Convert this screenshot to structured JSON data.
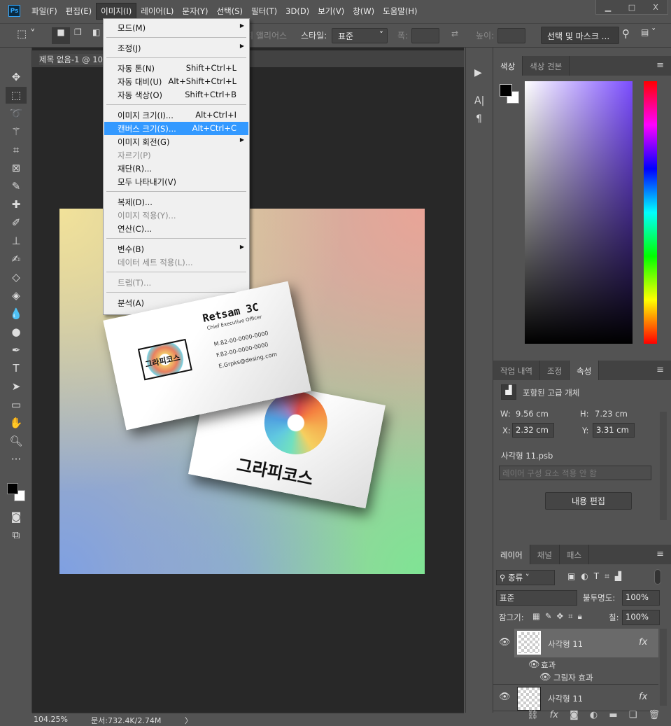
{
  "app": {
    "logo": "Ps",
    "window_controls": [
      "minimize-icon",
      "maximize-icon",
      "close-icon"
    ]
  },
  "menubar": [
    "파일(F)",
    "편집(E)",
    "이미지(I)",
    "레이어(L)",
    "문자(Y)",
    "선택(S)",
    "필터(T)",
    "3D(D)",
    "보기(V)",
    "창(W)",
    "도움말(H)"
  ],
  "options": {
    "antialias": "앤티 앨리어스",
    "style_label": "스타일:",
    "style_value": "표준",
    "width_label": "폭:",
    "height_label": "높이:",
    "select_mask": "선택 및 마스크 ..."
  },
  "document": {
    "tab_title": "제목 없음-1 @ 10",
    "zoom": "104.25%",
    "doc_size": "문서:732.4K/2.74M"
  },
  "image_menu": [
    {
      "label": "모드(M)",
      "submenu": true
    },
    {
      "sep": true
    },
    {
      "label": "조정(J)",
      "submenu": true
    },
    {
      "sep": true
    },
    {
      "label": "자동 톤(N)",
      "shortcut": "Shift+Ctrl+L"
    },
    {
      "label": "자동 대비(U)",
      "shortcut": "Alt+Shift+Ctrl+L"
    },
    {
      "label": "자동 색상(O)",
      "shortcut": "Shift+Ctrl+B"
    },
    {
      "sep": true
    },
    {
      "label": "이미지 크기(I)...",
      "shortcut": "Alt+Ctrl+I"
    },
    {
      "label": "캔버스 크기(S)...",
      "shortcut": "Alt+Ctrl+C",
      "highlighted": true
    },
    {
      "label": "이미지 회전(G)",
      "submenu": true
    },
    {
      "label": "자르기(P)",
      "disabled": true
    },
    {
      "label": "재단(R)..."
    },
    {
      "label": "모두 나타내기(V)"
    },
    {
      "sep": true
    },
    {
      "label": "복제(D)..."
    },
    {
      "label": "이미지 적용(Y)...",
      "disabled": true
    },
    {
      "label": "연산(C)..."
    },
    {
      "sep": true
    },
    {
      "label": "변수(B)",
      "submenu": true
    },
    {
      "label": "데이터 세트 적용(L)...",
      "disabled": true
    },
    {
      "sep": true
    },
    {
      "label": "트랩(T)...",
      "disabled": true
    },
    {
      "sep": true
    },
    {
      "label": "분석(A)",
      "submenu": true
    }
  ],
  "card_front": {
    "name": "Retsam 3C",
    "title": "Chief Executive Officer",
    "mobile": "M.82-00-0000-0000",
    "fax": "F.82-00-0000-0000",
    "email": "E.Grpks@desing.com",
    "logo_text": "그라피코스"
  },
  "card_back": {
    "logo_text": "그라피코스"
  },
  "color_panel": {
    "tabs": [
      "색상",
      "색상 견본"
    ],
    "foreground": "#000000",
    "background": "#ffffff",
    "hue_color": "#7b4dff"
  },
  "properties_panel": {
    "tabs": [
      "작업 내역",
      "조정",
      "속성"
    ],
    "type": "포함된 고급 개체",
    "w_label": "W:",
    "w": "9.56 cm",
    "h_label": "H:",
    "h": "7.23 cm",
    "x_label": "X:",
    "x": "2.32 cm",
    "y_label": "Y:",
    "y": "3.31 cm",
    "file": "사각형  11.psb",
    "comp": "레이어 구성 요소 적용 안 함",
    "edit_btn": "내용 편집"
  },
  "layers_panel": {
    "tabs": [
      "레이어",
      "채널",
      "패스"
    ],
    "filter": "종류",
    "blend": "표준",
    "opacity_label": "불투명도:",
    "opacity": "100%",
    "lock_label": "잠그기:",
    "fill_label": "칠:",
    "fill": "100%",
    "layers": [
      {
        "name": "사각형  11",
        "fx": "fx",
        "effects_label": "효과",
        "effect": "그림자 효과",
        "selected": true
      },
      {
        "name": "사각형  11",
        "fx": "fx"
      }
    ]
  },
  "accent": "#3399ff"
}
